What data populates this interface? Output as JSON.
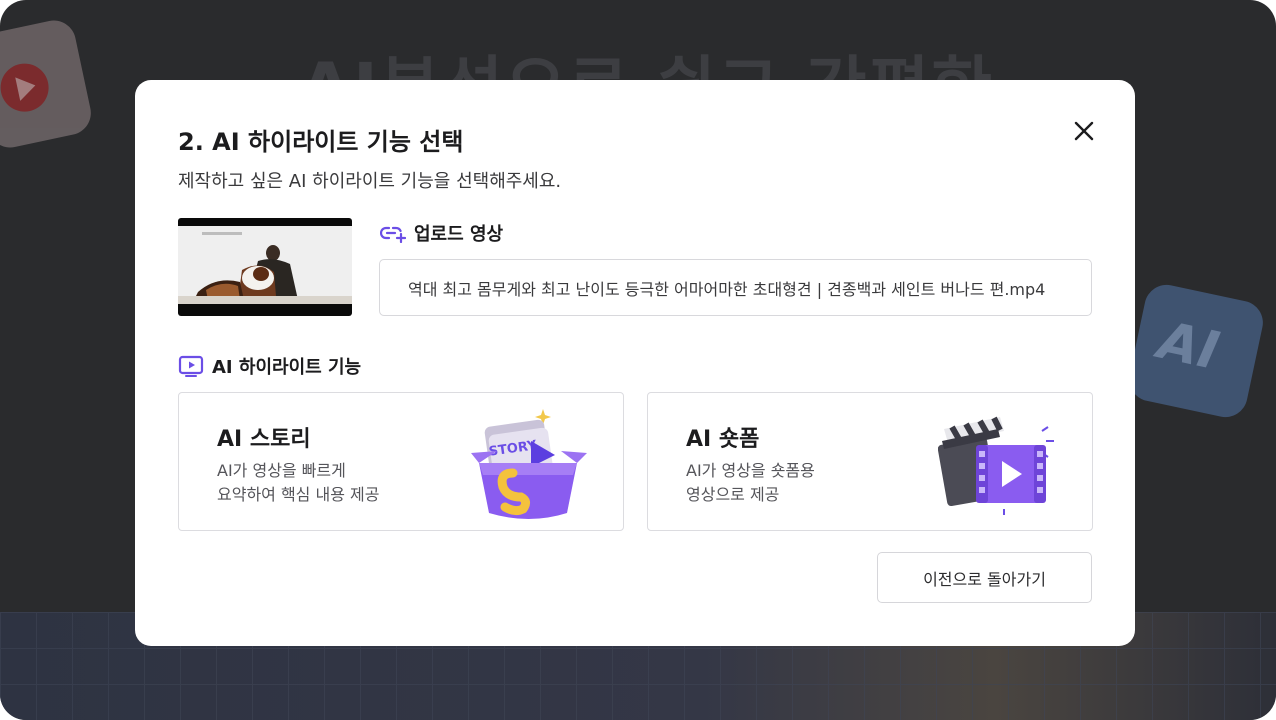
{
  "background": {
    "heading": "AI분석으로 쉽고 간편한",
    "ai_tile_text": "AI"
  },
  "modal": {
    "title": "2. AI 하이라이트 기능 선택",
    "subtitle": "제작하고 싶은 AI 하이라이트 기능을 선택해주세요.",
    "close_icon": "close-icon"
  },
  "upload": {
    "label": "업로드 영상",
    "icon": "link-upload-icon",
    "filename": "역대 최고 몸무게와 최고 난이도 등극한 어마어마한 초대형견 | 견종백과 세인트 버나드 편.mp4"
  },
  "features": {
    "label": "AI 하이라이트 기능",
    "icon": "play-screen-icon",
    "cards": [
      {
        "title": "AI 스토리",
        "desc_line1": "AI가 영상을 빠르게",
        "desc_line2": "요약하여 핵심 내용 제공",
        "badge_text": "STORY"
      },
      {
        "title": "AI 숏폼",
        "desc_line1": "AI가 영상을 숏폼용",
        "desc_line2": "영상으로 제공"
      }
    ]
  },
  "buttons": {
    "back": "이전으로 돌아가기"
  },
  "colors": {
    "accent": "#6b4ee6",
    "overlay": "#2a2b2d"
  }
}
